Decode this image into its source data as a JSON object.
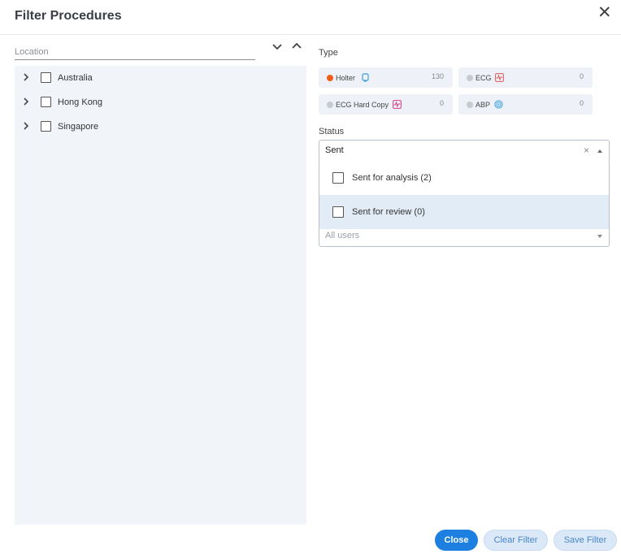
{
  "dialog": {
    "title": "Filter Procedures",
    "close_glyph": "✕"
  },
  "location": {
    "placeholder": "Location",
    "items": [
      {
        "label": "Australia"
      },
      {
        "label": "Hong Kong"
      },
      {
        "label": "Singapore"
      }
    ]
  },
  "type": {
    "label": "Type",
    "cards": [
      {
        "name": "Holter",
        "count": "130",
        "icon": "holter-device-icon",
        "dot_color": "#f25c19",
        "icon_color": "#3aa0dc"
      },
      {
        "name": "ECG",
        "count": "0",
        "icon": "ecg-wave-icon",
        "dot_color": "#c6cbd2",
        "icon_color": "#e05a5a"
      },
      {
        "name": "ECG Hard Copy",
        "count": "0",
        "icon": "ecg-hard-copy-icon",
        "dot_color": "#c6cbd2",
        "icon_color": "#d63c8a"
      },
      {
        "name": "ABP",
        "count": "0",
        "icon": "abp-gauge-icon",
        "dot_color": "#c6cbd2",
        "icon_color": "#3aa0dc"
      }
    ]
  },
  "status": {
    "label": "Status",
    "value": "Sent",
    "clear_glyph": "×",
    "options": [
      {
        "label": "Sent for analysis (2)"
      },
      {
        "label": "Sent for review (0)"
      }
    ]
  },
  "users": {
    "placeholder": "All users"
  },
  "footer": {
    "close_label": "Close",
    "clear_label": "Clear Filter",
    "save_label": "Save Filter"
  },
  "colors": {
    "primary": "#1d7fe0",
    "panel_bg": "#f1f5fa",
    "highlight_bg": "#e1ecf7"
  }
}
